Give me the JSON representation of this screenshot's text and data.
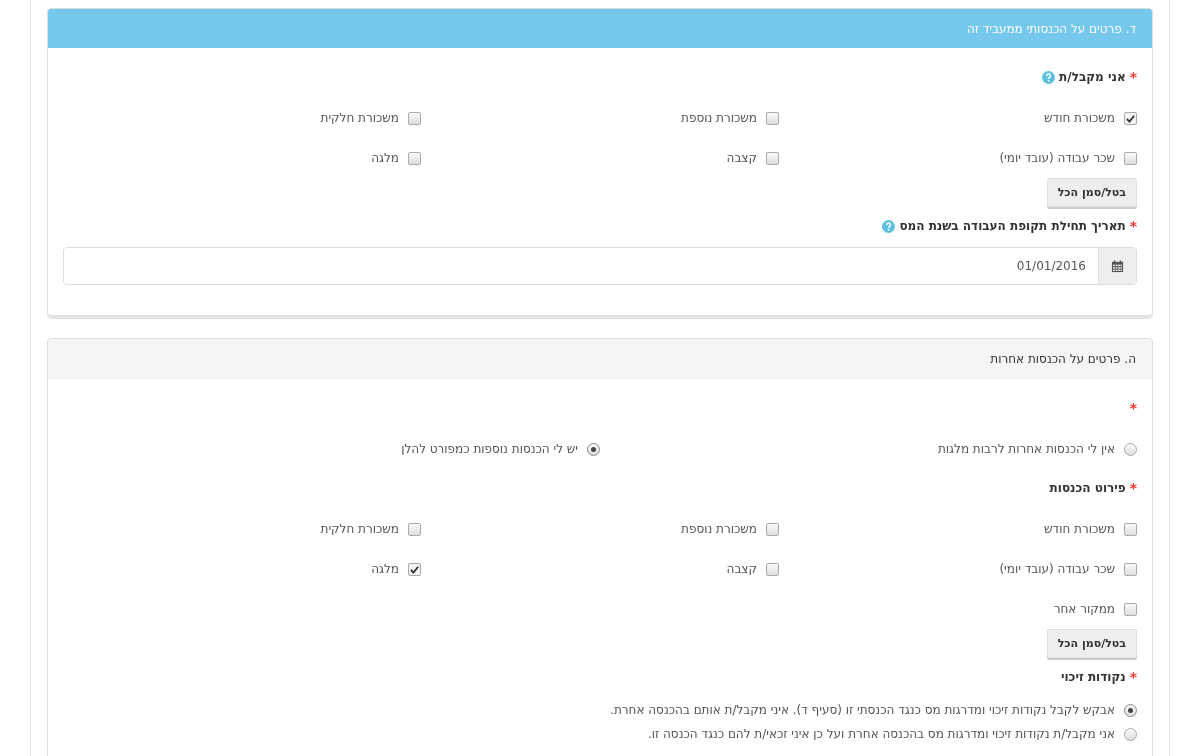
{
  "sections": [
    {
      "title": "ד. פרטים על הכנסותי ממעביד זה",
      "kind": "primary",
      "fields": [
        {
          "kind": "checkboxes",
          "mark": "*",
          "label": "אני מקבל/ת",
          "help": true,
          "button": "בטל/סמן הכל",
          "options": [
            {
              "label": "משכורת חודש",
              "checked": true
            },
            {
              "label": "משכורת נוספת",
              "checked": false
            },
            {
              "label": "משכורת חלקית",
              "checked": false
            },
            {
              "label": "שכר עבודה (עובד יומי)",
              "checked": false
            },
            {
              "label": "קצבה",
              "checked": false
            },
            {
              "label": "מלגה",
              "checked": false
            }
          ]
        },
        {
          "kind": "date",
          "mark": "*",
          "label": "תאריך תחילת תקופת העבודה בשנת המס",
          "help": true,
          "value": "01/01/2016"
        }
      ]
    },
    {
      "title": "ה. פרטים על הכנסות אחרות",
      "kind": "default",
      "fields": [
        {
          "kind": "radio_row",
          "mark": "*",
          "options": [
            {
              "label": "אין לי הכנסות אחרות לרבות מלגות",
              "selected": false
            },
            {
              "label": "יש לי הכנסות נוספות כמפורט להלן",
              "selected": true
            }
          ]
        },
        {
          "kind": "checkboxes",
          "mark": "*",
          "label": "פירוט הכנסות",
          "button": "בטל/סמן הכל",
          "options": [
            {
              "label": "משכורת חודש",
              "checked": false
            },
            {
              "label": "משכורת נוספת",
              "checked": false
            },
            {
              "label": "משכורת חלקית",
              "checked": false
            },
            {
              "label": "שכר עבודה (עובד יומי)",
              "checked": false
            },
            {
              "label": "קצבה",
              "checked": false
            },
            {
              "label": "מלגה",
              "checked": true
            },
            {
              "label": "ממקור אחר",
              "checked": false
            }
          ]
        },
        {
          "kind": "radio_stack",
          "mark": "*",
          "label": "נקודות זיכוי",
          "options": [
            {
              "label": "אבקש לקבל נקודות זיכוי ומדרגות מס כנגד הכנסתי זו (סעיף ד). איני מקבל/ת אותם בהכנסה אחרת.",
              "selected": true
            },
            {
              "label": "אני מקבל/ת נקודות זיכוי ומדרגות מס בהכנסה אחרת ועל כן איני זכאי/ת להם כנגד הכנסה זו.",
              "selected": false
            }
          ]
        }
      ]
    }
  ]
}
